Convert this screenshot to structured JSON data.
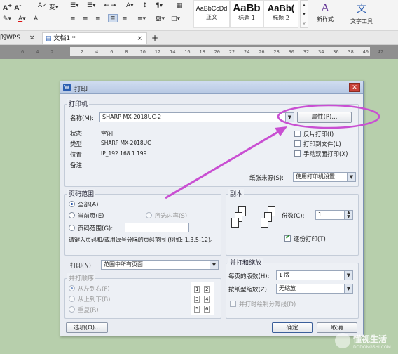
{
  "ribbon": {
    "row1": [
      "Aˆ Aˇ",
      "☰",
      "À",
      "≡",
      "≡",
      "Aˆ",
      "¶",
      "↔"
    ],
    "styles": [
      {
        "preview": "AaBbCcDd",
        "caption": "正文"
      },
      {
        "preview": "AaBb",
        "caption": "标题 1"
      },
      {
        "preview": "AaBb(",
        "caption": "标题 2"
      }
    ],
    "new_style": "新样式",
    "text_tools": "文字工具"
  },
  "tabs": {
    "left_partial": "的WPS",
    "doc_tab": "文档1 *",
    "add": "+"
  },
  "ruler": {
    "ticks": [
      "6",
      "4",
      "2",
      "",
      "2",
      "4",
      "6",
      "8",
      "10",
      "12",
      "14",
      "16",
      "18",
      "20",
      "22",
      "24",
      "26",
      "28",
      "30",
      "32",
      "34",
      "36",
      "38",
      "40",
      "42"
    ]
  },
  "dialog": {
    "title": "打印",
    "close": "✕",
    "printer_group": "打印机",
    "name_label": "名称(M):",
    "printer_name": "SHARP MX-2018UC-2",
    "properties_button": "属性(P)...",
    "status_label": "状态:",
    "status_value": "空闲",
    "type_label": "类型:",
    "type_value": "SHARP MX-2018UC",
    "location_label": "位置:",
    "location_value": "IP_192.168.1.199",
    "comment_label": "备注:",
    "reverse_print": "反片打印(I)",
    "print_to_file": "打印到文件(L)",
    "manual_duplex": "手动双面打印(X)",
    "paper_source_label": "纸张来源(S):",
    "paper_source_value": "使用打印机设置",
    "page_range_group": "页码范围",
    "all": "全部(A)",
    "current_page": "当前页(E)",
    "selection": "所选内容(S)",
    "page_range": "页码范围(G):",
    "hint": "请键入页码和/或用逗号分隔的页码范围 (例如: 1,3,5-12)。",
    "print_label": "打印(N):",
    "print_value": "范围中所有页面",
    "print_order_group": "并打顺序",
    "left_to_right": "从左到右(F)",
    "top_to_bottom": "从上到下(B)",
    "repeat": "重复(R)",
    "copies_group": "副本",
    "copies_label": "份数(C):",
    "copies_value": "1",
    "collate": "逐份打印(T)",
    "zoom_group": "并打和缩放",
    "pages_per_sheet_label": "每页的版数(H):",
    "pages_per_sheet_value": "1 版",
    "scale_label": "按纸型缩放(Z):",
    "scale_value": "无缩放",
    "draw_border": "并打时绘制分隔线(D)",
    "options_button": "选项(O)...",
    "ok_button": "确定",
    "cancel_button": "取消",
    "page_numbers": [
      "1",
      "2",
      "3",
      "4",
      "5",
      "6"
    ]
  },
  "watermark": {
    "brand": "懂视生活",
    "url": "DDDONGSHI.COM"
  },
  "colors": {
    "highlight_ellipse": "#c94fd2",
    "arrow": "#c94fd2",
    "doc_background": "#b7cfac"
  }
}
